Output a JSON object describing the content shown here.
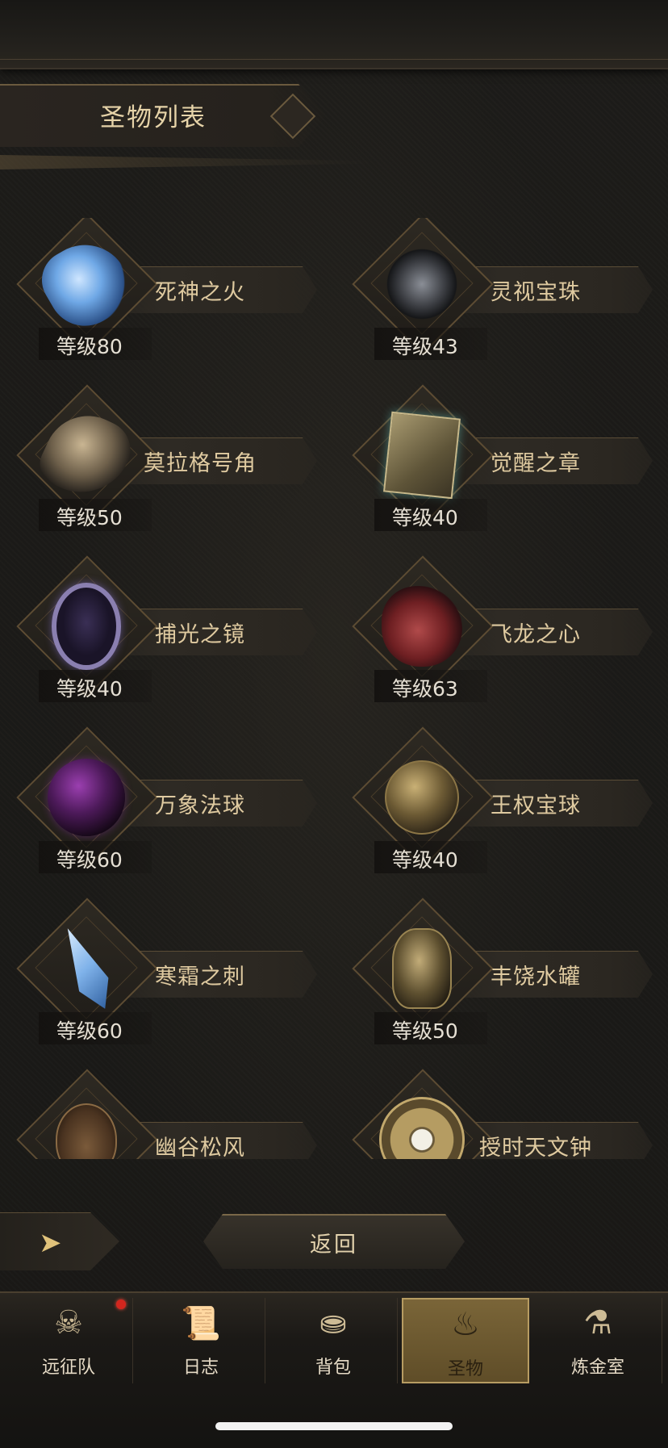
{
  "header": {
    "title": "圣物列表"
  },
  "relics": [
    {
      "name": "死神之火",
      "level": "等级80",
      "icon": "spectral-hand-icon",
      "art": "hand"
    },
    {
      "name": "灵视宝珠",
      "level": "等级43",
      "icon": "eye-orb-amulet-icon",
      "art": "orb-eye"
    },
    {
      "name": "莫拉格号角",
      "level": "等级50",
      "icon": "horn-icon",
      "art": "horn"
    },
    {
      "name": "觉醒之章",
      "level": "等级40",
      "icon": "tome-icon",
      "art": "book"
    },
    {
      "name": "捕光之镜",
      "level": "等级40",
      "icon": "mirror-icon",
      "art": "mirror"
    },
    {
      "name": "飞龙之心",
      "level": "等级63",
      "icon": "dragon-heart-icon",
      "art": "heart"
    },
    {
      "name": "万象法球",
      "level": "等级60",
      "icon": "purple-sphere-icon",
      "art": "sphere-purple"
    },
    {
      "name": "王权宝球",
      "level": "等级40",
      "icon": "royal-orb-icon",
      "art": "globus"
    },
    {
      "name": "寒霜之刺",
      "level": "等级60",
      "icon": "ice-crystal-icon",
      "art": "crystal"
    },
    {
      "name": "丰饶水罐",
      "level": "等级50",
      "icon": "water-jar-icon",
      "art": "jar"
    },
    {
      "name": "幽谷松风",
      "level": "",
      "icon": "lute-icon",
      "art": "lute"
    },
    {
      "name": "授时天文钟",
      "level": "",
      "icon": "astronomical-clock-icon",
      "art": "clock"
    }
  ],
  "controls": {
    "return_label": "返回",
    "back_glyph": "➤"
  },
  "nav": [
    {
      "label": "远征队",
      "icon": "viking-helmet-icon",
      "glyph": "☠",
      "active": false,
      "badge": true
    },
    {
      "label": "日志",
      "icon": "scroll-log-icon",
      "glyph": "📜",
      "active": false,
      "badge": false
    },
    {
      "label": "背包",
      "icon": "backpack-icon",
      "glyph": "⛂",
      "active": false,
      "badge": false
    },
    {
      "label": "圣物",
      "icon": "torch-relic-icon",
      "glyph": "♨",
      "active": true,
      "badge": false
    },
    {
      "label": "炼金室",
      "icon": "alchemy-icon",
      "glyph": "⚗",
      "active": false,
      "badge": false
    }
  ]
}
